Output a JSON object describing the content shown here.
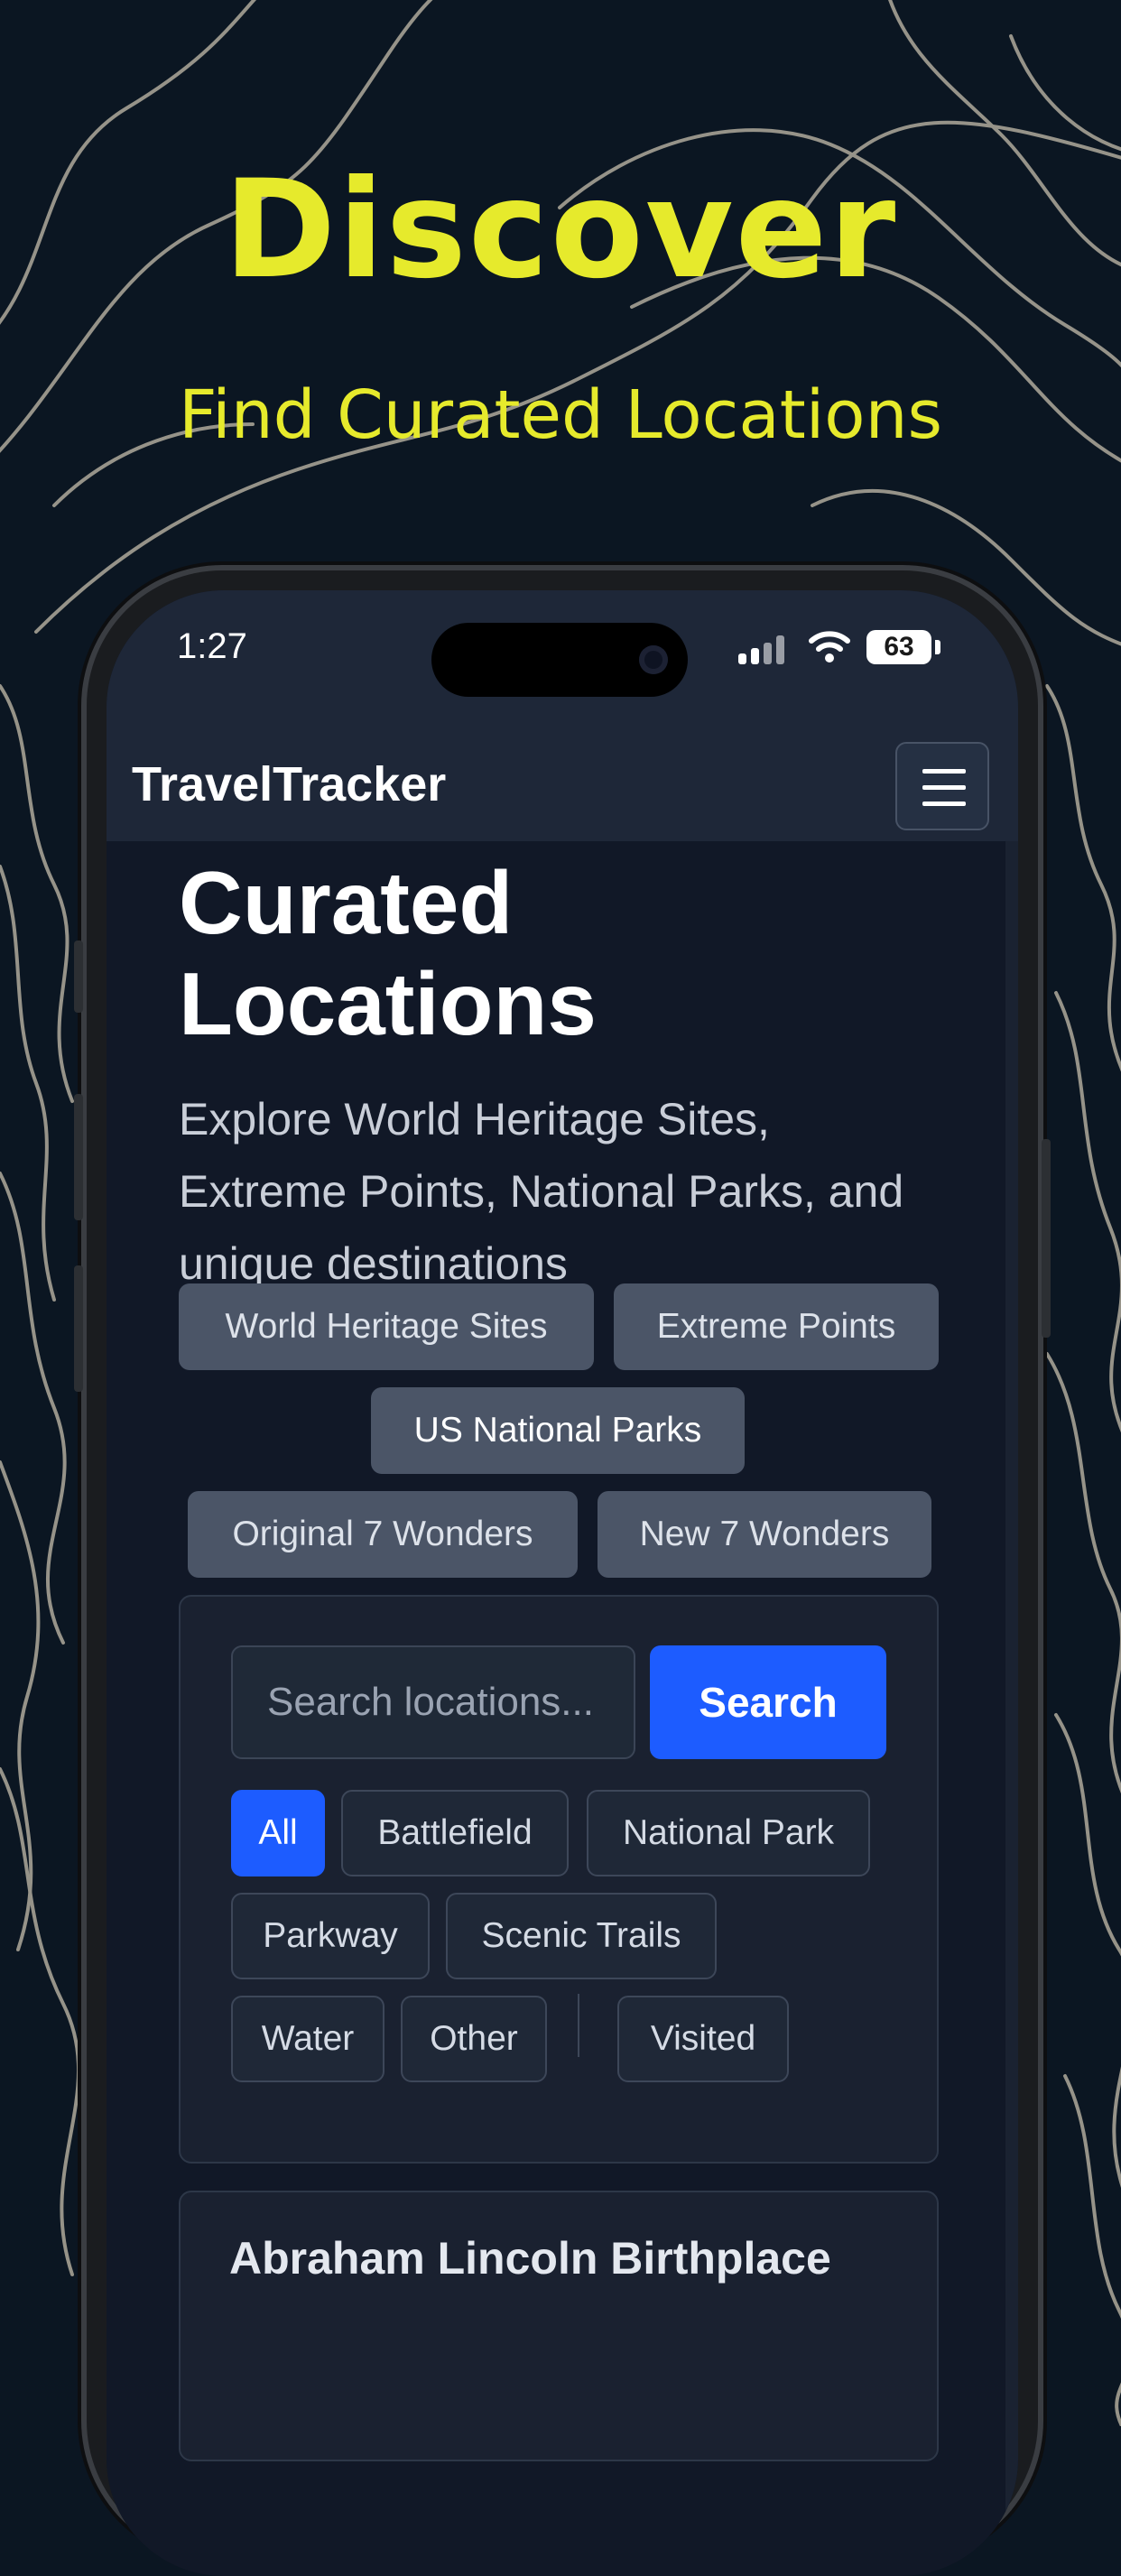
{
  "promo": {
    "title": "Discover",
    "subtitle": "Find Curated Locations"
  },
  "status_bar": {
    "time": "1:27",
    "battery": "63"
  },
  "navbar": {
    "brand": "TravelTracker",
    "menu_icon": "hamburger-menu-icon"
  },
  "hero": {
    "title": "Curated Locations",
    "description": "Explore World Heritage Sites, Extreme Points, National Parks, and unique destinations"
  },
  "collections": [
    {
      "label": "World Heritage Sites",
      "active": false
    },
    {
      "label": "Extreme Points",
      "active": false
    },
    {
      "label": "US National Parks",
      "active": true
    },
    {
      "label": "Original 7 Wonders",
      "active": false
    },
    {
      "label": "New 7 Wonders",
      "active": false
    }
  ],
  "search": {
    "placeholder": "Search locations...",
    "button_label": "Search"
  },
  "type_filters": [
    {
      "label": "All",
      "active": true
    },
    {
      "label": "Battlefield",
      "active": false
    },
    {
      "label": "National Park",
      "active": false
    },
    {
      "label": "Parkway",
      "active": false
    },
    {
      "label": "Scenic Trails",
      "active": false
    },
    {
      "label": "Water",
      "active": false
    },
    {
      "label": "Other",
      "active": false
    },
    {
      "label": "Visited",
      "active": false
    }
  ],
  "results": [
    {
      "title": "Abraham Lincoln Birthplace"
    }
  ],
  "colors": {
    "promo_accent": "#e6ea2c",
    "primary_blue": "#1d5cff",
    "app_background": "#111827",
    "navbar_background": "#1e2738"
  }
}
